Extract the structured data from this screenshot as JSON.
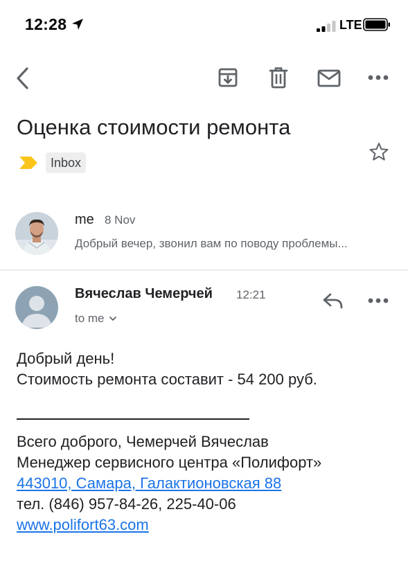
{
  "status_bar": {
    "time": "12:28",
    "network": "LTE",
    "icons": [
      "location-arrow-icon",
      "signal-icon",
      "battery-icon"
    ]
  },
  "toolbar": {
    "icons": [
      "back-icon",
      "archive-icon",
      "trash-icon",
      "mail-icon",
      "more-icon"
    ]
  },
  "email": {
    "subject": "Оценка стоимости ремонта",
    "label": "Inbox",
    "label_color": "#F9C51B",
    "star_icon": "star-outline-icon"
  },
  "collapsed_message": {
    "sender": "me",
    "date": "8 Nov",
    "snippet": "Добрый вечер, звонил вам по поводу проблемы..."
  },
  "expanded_message": {
    "sender": "Вячеслав Чемерчей",
    "time": "12:21",
    "recipient": "to me",
    "body": {
      "greeting": "Добрый день!",
      "line": "Стоимость ремонта составит - 54 200 руб.",
      "signature_1": "Всего доброго, Чемерчей Вячеслав",
      "signature_2": "Менеджер сервисного центра «Полифорт»",
      "address_link": "443010, Самара, Галактионовская 88",
      "phone": "тел. (846) 957-84-26, 225-40-06",
      "website_link": "www.polifort63.com"
    }
  },
  "colors": {
    "link": "#1a73e8",
    "secondary_text": "#5f6368",
    "icon_gray": "#5f6368",
    "avatar_default_bg": "#8da3b3"
  }
}
